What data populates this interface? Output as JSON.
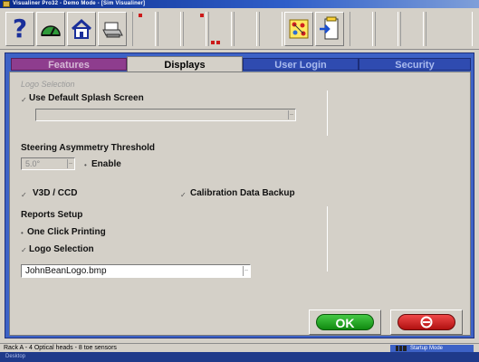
{
  "window": {
    "title": "Visualiner Pro32 - Demo Mode - [Sim Visualiner]"
  },
  "toolbar": {
    "help_icon": "question-mark-icon",
    "gauge_icon": "speedometer-icon",
    "home_icon": "house-icon",
    "print_icon": "printer-icon",
    "graph_icon": "graph-icon",
    "dialog_icon": "dialog-exit-icon"
  },
  "tabs": [
    {
      "label": "Features"
    },
    {
      "label": "Displays"
    },
    {
      "label": "User Login"
    },
    {
      "label": "Security"
    }
  ],
  "content": {
    "logo_section_title": "Logo Selection",
    "use_default_splash_label": "Use Default Splash Screen",
    "splash_field_value": "",
    "steering_title": "Steering Asymmetry Threshold",
    "steering_value": "5.0°",
    "enable_label": "Enable",
    "v3d_label": "V3D / CCD",
    "calibration_label": "Calibration Data Backup",
    "reports_title": "Reports Setup",
    "one_click_label": "One Click Printing",
    "logo_selection_label": "Logo Selection",
    "logo_file_value": "JohnBeanLogo.bmp"
  },
  "buttons": {
    "ok_label": "OK",
    "cancel_icon": "no-entry-icon"
  },
  "status": {
    "left_text": "Rack A - 4 Optical heads - 8 toe sensors",
    "mode_text": "Startup Mode",
    "bottom_text": "Desktop"
  },
  "colors": {
    "panel_blue": "#3d62c6",
    "tab_purple": "#8e3d8e",
    "ok_green": "#1ea01e",
    "cancel_red": "#d02020"
  }
}
